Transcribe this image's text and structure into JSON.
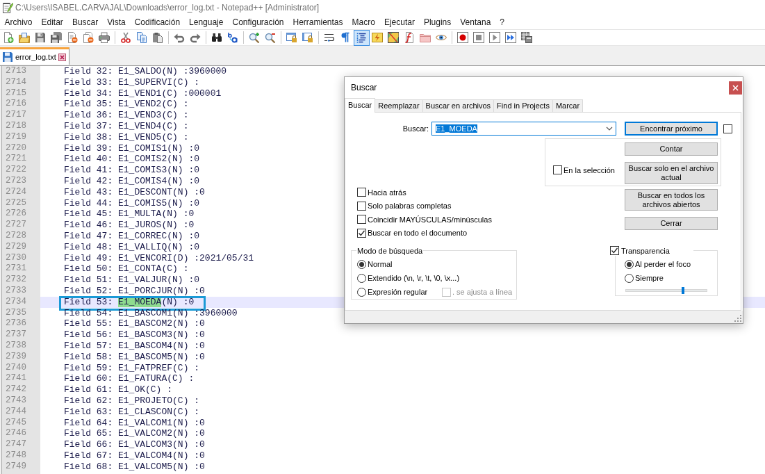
{
  "window": {
    "title": "C:\\Users\\ISABEL.CARVAJAL\\Downloads\\error_log.txt - Notepad++ [Administrator]"
  },
  "menu": [
    "Archivo",
    "Editar",
    "Buscar",
    "Vista",
    "Codificación",
    "Lenguaje",
    "Configuración",
    "Herramientas",
    "Macro",
    "Ejecutar",
    "Plugins",
    "Ventana",
    "?"
  ],
  "toolbar": {
    "groups": [
      [
        {
          "pressed": false
        },
        {
          "pressed": false
        },
        {
          "pressed": false
        },
        {
          "pressed": false
        },
        {
          "pressed": false
        },
        {
          "pressed": false
        },
        {
          "pressed": false
        }
      ],
      [
        {
          "pressed": false
        },
        {
          "pressed": false
        },
        {
          "pressed": false
        }
      ],
      [
        {
          "pressed": false
        },
        {
          "pressed": false
        }
      ],
      [
        {
          "pressed": false
        },
        {
          "pressed": false
        }
      ],
      [
        {
          "pressed": false
        },
        {
          "pressed": false
        }
      ],
      [
        {
          "pressed": false
        },
        {
          "pressed": false
        }
      ],
      [
        {
          "pressed": false
        },
        {
          "pressed": false
        },
        {
          "pressed": true
        },
        {
          "pressed": false
        },
        {
          "pressed": false
        },
        {
          "pressed": false
        },
        {
          "pressed": false
        },
        {
          "pressed": false
        }
      ],
      [
        {
          "pressed": false
        },
        {
          "pressed": false
        },
        {
          "pressed": false
        },
        {
          "pressed": false
        },
        {
          "pressed": false
        }
      ]
    ]
  },
  "tabs": [
    {
      "label": "error_log.txt",
      "selected": true
    }
  ],
  "editor": {
    "lines": [
      {
        "number": "2713",
        "text": "Field 32: E1_SALDO(N) :3960000",
        "current": false,
        "outlined": false
      },
      {
        "number": "2714",
        "text": "Field 33: E1_SUPERVI(C) :",
        "current": false,
        "outlined": false
      },
      {
        "number": "2715",
        "text": "Field 34: E1_VEND1(C) :000001",
        "current": false,
        "outlined": false
      },
      {
        "number": "2716",
        "text": "Field 35: E1_VEND2(C) :",
        "current": false,
        "outlined": false
      },
      {
        "number": "2717",
        "text": "Field 36: E1_VEND3(C) :",
        "current": false,
        "outlined": false
      },
      {
        "number": "2718",
        "text": "Field 37: E1_VEND4(C) :",
        "current": false,
        "outlined": false
      },
      {
        "number": "2719",
        "text": "Field 38: E1_VEND5(C) :",
        "current": false,
        "outlined": false
      },
      {
        "number": "2720",
        "text": "Field 39: E1_COMIS1(N) :0",
        "current": false,
        "outlined": false
      },
      {
        "number": "2721",
        "text": "Field 40: E1_COMIS2(N) :0",
        "current": false,
        "outlined": false
      },
      {
        "number": "2722",
        "text": "Field 41: E1_COMIS3(N) :0",
        "current": false,
        "outlined": false
      },
      {
        "number": "2723",
        "text": "Field 42: E1_COMIS4(N) :0",
        "current": false,
        "outlined": false
      },
      {
        "number": "2724",
        "text": "Field 43: E1_DESCONT(N) :0",
        "current": false,
        "outlined": false
      },
      {
        "number": "2725",
        "text": "Field 44: E1_COMIS5(N) :0",
        "current": false,
        "outlined": false
      },
      {
        "number": "2726",
        "text": "Field 45: E1_MULTA(N) :0",
        "current": false,
        "outlined": false
      },
      {
        "number": "2727",
        "text": "Field 46: E1_JUROS(N) :0",
        "current": false,
        "outlined": false
      },
      {
        "number": "2728",
        "text": "Field 47: E1_CORREC(N) :0",
        "current": false,
        "outlined": false
      },
      {
        "number": "2729",
        "text": "Field 48: E1_VALLIQ(N) :0",
        "current": false,
        "outlined": false
      },
      {
        "number": "2730",
        "text": "Field 49: E1_VENCORI(D) :2021/05/31",
        "current": false,
        "outlined": false
      },
      {
        "number": "2731",
        "text": "Field 50: E1_CONTA(C) :",
        "current": false,
        "outlined": false
      },
      {
        "number": "2732",
        "text": "Field 51: E1_VALJUR(N) :0",
        "current": false,
        "outlined": false
      },
      {
        "number": "2733",
        "text": "Field 52: E1_PORCJUR(N) :0",
        "current": false,
        "outlined": false
      },
      {
        "number": "2734",
        "segments": [
          {
            "text": "Field 53: ",
            "highlighted": false
          },
          {
            "text": "E1_MOEDA",
            "highlighted": true
          },
          {
            "text": "(N) :0",
            "highlighted": false
          }
        ],
        "current": true,
        "outlined": true
      },
      {
        "number": "2735",
        "text": "Field 54: E1_BASCOM1(N) :3960000",
        "current": false,
        "outlined": false
      },
      {
        "number": "2736",
        "text": "Field 55: E1_BASCOM2(N) :0",
        "current": false,
        "outlined": false
      },
      {
        "number": "2737",
        "text": "Field 56: E1_BASCOM3(N) :0",
        "current": false,
        "outlined": false
      },
      {
        "number": "2738",
        "text": "Field 57: E1_BASCOM4(N) :0",
        "current": false,
        "outlined": false
      },
      {
        "number": "2739",
        "text": "Field 58: E1_BASCOM5(N) :0",
        "current": false,
        "outlined": false
      },
      {
        "number": "2740",
        "text": "Field 59: E1_FATPREF(C) :",
        "current": false,
        "outlined": false
      },
      {
        "number": "2741",
        "text": "Field 60: E1_FATURA(C) :",
        "current": false,
        "outlined": false
      },
      {
        "number": "2742",
        "text": "Field 61: E1_OK(C) :",
        "current": false,
        "outlined": false
      },
      {
        "number": "2743",
        "text": "Field 62: E1_PROJETO(C) :",
        "current": false,
        "outlined": false
      },
      {
        "number": "2744",
        "text": "Field 63: E1_CLASCON(C) :",
        "current": false,
        "outlined": false
      },
      {
        "number": "2745",
        "text": "Field 64: E1_VALCOM1(N) :0",
        "current": false,
        "outlined": false
      },
      {
        "number": "2746",
        "text": "Field 65: E1_VALCOM2(N) :0",
        "current": false,
        "outlined": false
      },
      {
        "number": "2747",
        "text": "Field 66: E1_VALCOM3(N) :0",
        "current": false,
        "outlined": false
      },
      {
        "number": "2748",
        "text": "Field 67: E1_VALCOM4(N) :0",
        "current": false,
        "outlined": false
      },
      {
        "number": "2749",
        "text": "Field 68: E1_VALCOM5(N) :0",
        "current": false,
        "outlined": false
      }
    ]
  },
  "find_dialog": {
    "title": "Buscar",
    "tabs": [
      {
        "label": "Buscar",
        "selected": true
      },
      {
        "label": "Reemplazar",
        "selected": false
      },
      {
        "label": "Buscar en archivos",
        "selected": false
      },
      {
        "label": "Find in Projects",
        "selected": false
      },
      {
        "label": "Marcar",
        "selected": false
      }
    ],
    "search_field": {
      "label": "Buscar:",
      "value": "E1_MOEDA",
      "text_selected": true
    },
    "find_next_button": {
      "label": "Encontrar próximo",
      "default": true
    },
    "checkbox_beside_find_next": {
      "checked": false
    },
    "selection_box": {
      "checkbox": {
        "label": "En la selección",
        "checked": false
      },
      "buttons": [
        "Contar",
        "Buscar solo en el archivo actual"
      ]
    },
    "options": [
      {
        "label": "Hacia atrás",
        "checked": false
      },
      {
        "label": "Solo palabras completas",
        "checked": false
      },
      {
        "label": "Coincidir MAYÚSCULAS/minúsculas",
        "checked": false
      },
      {
        "label": "Buscar en todo el documento",
        "checked": true
      }
    ],
    "side_buttons": [
      "Buscar en todos los archivos abiertos",
      "Cerrar"
    ],
    "search_mode": {
      "title": "Modo de búsqueda",
      "options": [
        {
          "label": "Normal",
          "selected": true
        },
        {
          "label": "Extendido (\\n, \\r, \\t, \\0, \\x...)",
          "selected": false
        },
        {
          "label": "Expresión regular",
          "selected": false
        }
      ],
      "dot_matches_newline": {
        "label": ". se ajusta a línea",
        "checked": false,
        "disabled": true
      }
    },
    "transparency": {
      "label": "Transparencia",
      "checked": true,
      "options": [
        {
          "label": "Al perder el foco",
          "selected": true
        },
        {
          "label": "Siempre",
          "selected": false
        }
      ],
      "level": 0.71
    }
  }
}
